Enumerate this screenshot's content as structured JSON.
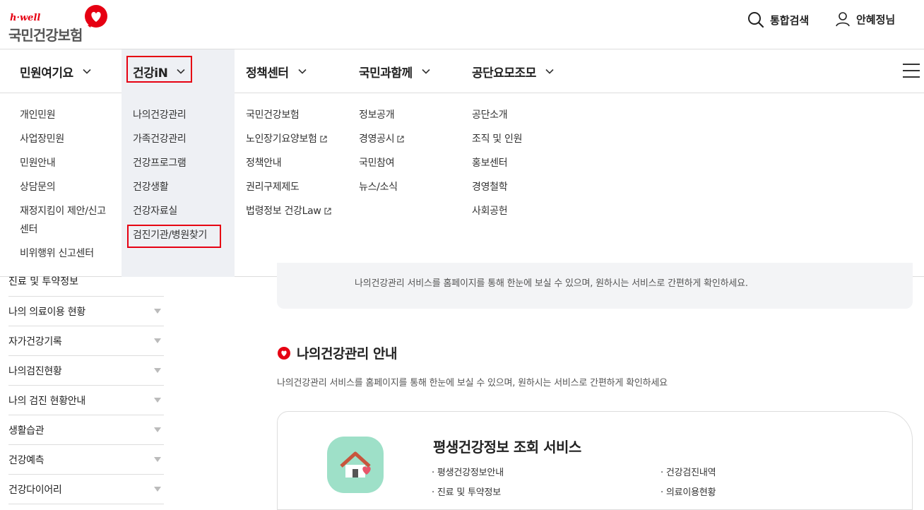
{
  "header": {
    "brand": "h·well",
    "org_name": "국민건강보험",
    "search_label": "통합검색",
    "user_label": "안혜정님"
  },
  "gnb": {
    "items": [
      {
        "label": "민원여기요"
      },
      {
        "label": "건강iN",
        "active": true
      },
      {
        "label": "정책센터"
      },
      {
        "label": "국민과함께"
      },
      {
        "label": "공단요모조모"
      }
    ]
  },
  "dropdown": {
    "columns": [
      {
        "items": [
          "개인민원",
          "사업장민원",
          "민원안내",
          "상담문의",
          "재정지킴이 제안/신고센터",
          "비위행위 신고센터"
        ]
      },
      {
        "items": [
          "나의건강관리",
          "가족건강관리",
          "건강프로그램",
          "건강생활",
          "건강자료실",
          "검진기관/병원찾기"
        ]
      },
      {
        "items": [
          "국민건강보험",
          "노인장기요양보험",
          "정책안내",
          "권리구제제도",
          "법령정보 건강Law"
        ]
      },
      {
        "items": [
          "정보공개",
          "경영공시",
          "국민참여",
          "뉴스/소식"
        ]
      },
      {
        "items": [
          "공단소개",
          "조직 및 인원",
          "홍보센터",
          "경영철학",
          "사회공헌"
        ]
      }
    ],
    "col1_wrap": [
      "재정지킴이 제안/신고",
      "센터"
    ]
  },
  "side_menu": {
    "top_label": "진료 및 투약정보",
    "items": [
      "나의 의료이용 현황",
      "자가건강기록",
      "나의검진현황",
      "나의 검진 현황안내",
      "생활습관",
      "건강예측",
      "건강다이어리"
    ]
  },
  "main": {
    "intro_text": "나의건강관리 서비스를 홈페이지를 통해 한눈에 보실 수 있으며, 원하시는 서비스로 간편하게 확인하세요.",
    "section_title": "나의건강관리 안내",
    "section_desc": "나의건강관리 서비스를 홈페이지를 통해 한눈에 보실 수 있으며, 원하시는 서비스로 간편하게 확인하세요",
    "card": {
      "title": "평생건강정보 조회 서비스",
      "bullets_left": [
        "평생건강정보안내",
        "진료 및 투약정보"
      ],
      "bullets_right": [
        "건강검진내역",
        "의료이용현황"
      ]
    }
  },
  "colors": {
    "accent": "#e60012",
    "active_bg": "#eef0f4",
    "card_icon_bg": "#9ee0c8"
  }
}
